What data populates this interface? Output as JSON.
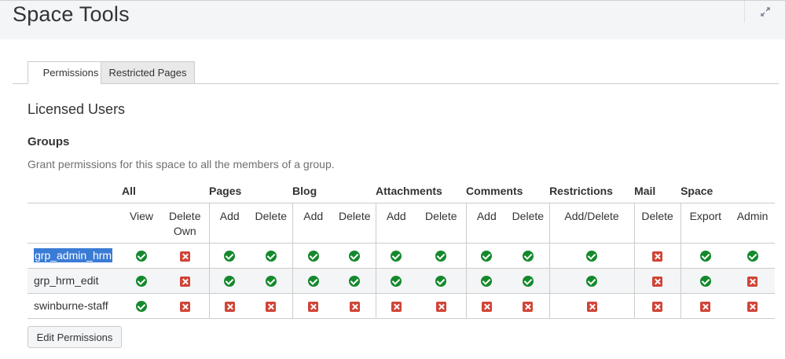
{
  "header": {
    "title": "Space Tools"
  },
  "tabs": [
    {
      "label": "Permissions",
      "active": true
    },
    {
      "label": "Restricted Pages",
      "active": false
    }
  ],
  "section": {
    "title": "Licensed Users",
    "groups_title": "Groups",
    "groups_desc": "Grant permissions for this space to all the members of a group."
  },
  "table": {
    "categories": [
      "All",
      "Pages",
      "Blog",
      "Attachments",
      "Comments",
      "Restrictions",
      "Mail",
      "Space"
    ],
    "subheaders": [
      "View",
      "Delete Own",
      "Add",
      "Delete",
      "Add",
      "Delete",
      "Add",
      "Delete",
      "Add",
      "Delete",
      "Add/Delete",
      "Delete",
      "Export",
      "Admin"
    ],
    "rows": [
      {
        "name": "grp_admin_hrm",
        "selected": true,
        "perms": [
          true,
          false,
          true,
          true,
          true,
          true,
          true,
          true,
          true,
          true,
          true,
          false,
          true,
          true
        ]
      },
      {
        "name": "grp_hrm_edit",
        "selected": false,
        "perms": [
          true,
          false,
          true,
          true,
          true,
          true,
          true,
          true,
          true,
          true,
          true,
          false,
          true,
          false
        ]
      },
      {
        "name": "swinburne-staff",
        "selected": false,
        "perms": [
          true,
          false,
          false,
          false,
          false,
          false,
          false,
          false,
          false,
          false,
          false,
          false,
          false,
          false
        ]
      }
    ]
  },
  "edit_button": {
    "label": "Edit Permissions"
  },
  "icons": {
    "granted": "check-circle-icon",
    "denied": "cross-square-icon",
    "expand": "expand-icon"
  },
  "colors": {
    "granted": "#14892c",
    "denied": "#d04437",
    "selection": "#3a7bd5"
  }
}
